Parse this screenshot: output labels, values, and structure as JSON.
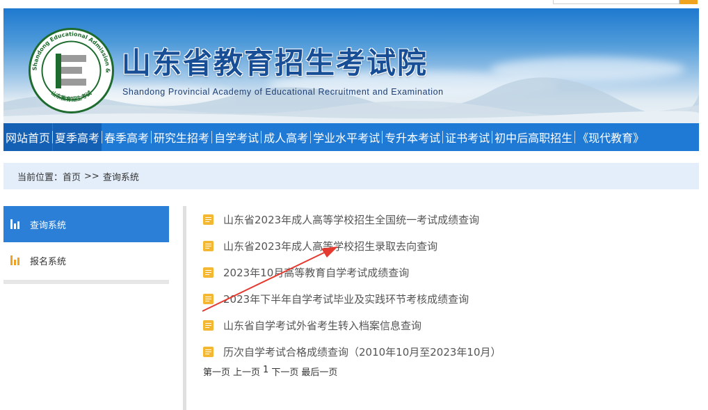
{
  "header": {
    "title_cn": "山东省教育招生考试院",
    "title_en": "Shandong Provincial Academy of Educational Recruitment and Examination",
    "logo_ring_text": "Shandong Educational Admission & Examinations",
    "logo_bottom_text": "山东教育招生考试",
    "logo_letter": "E"
  },
  "nav": {
    "items": [
      {
        "label": "网站首页",
        "active": true
      },
      {
        "label": "夏季高考",
        "active": true
      },
      {
        "label": "春季高考",
        "active": false
      },
      {
        "label": "研究生招考",
        "active": false
      },
      {
        "label": "自学考试",
        "active": false
      },
      {
        "label": "成人高考",
        "active": false
      },
      {
        "label": "学业水平考试",
        "active": false
      },
      {
        "label": "专升本考试",
        "active": false
      },
      {
        "label": "证书考试",
        "active": false
      },
      {
        "label": "初中后高职招生",
        "active": false
      },
      {
        "label": "《现代教育》",
        "active": false
      }
    ]
  },
  "breadcrumb": {
    "prefix": "当前位置：",
    "home": "首页",
    "sep": ">>",
    "current": "查询系统"
  },
  "sidebar": {
    "items": [
      {
        "label": "查询系统",
        "icon": "bar-chart-icon",
        "active": true
      },
      {
        "label": "报名系统",
        "icon": "bar-chart-icon",
        "active": false
      }
    ]
  },
  "list": {
    "items": [
      "山东省2023年成人高等学校招生全国统一考试成绩查询",
      "山东省2023年成人高等学校招生录取去向查询",
      "2023年10月高等教育自学考试成绩查询",
      "2023年下半年自学考试毕业及实践环节考核成绩查询",
      "山东省自学考试外省考生转入档案信息查询",
      "历次自学考试合格成绩查询（2010年10月至2023年10月）"
    ]
  },
  "pager": {
    "first": "第一页",
    "prev": "上一页",
    "current": "1",
    "next": "下一页",
    "last": "最后一页"
  },
  "colors": {
    "nav_bg": "#1f7ad6",
    "nav_active": "#1460b4",
    "sidebar_active": "#2b7fd7",
    "doc_icon": "#f4b731",
    "arrow": "#e53a2f"
  }
}
